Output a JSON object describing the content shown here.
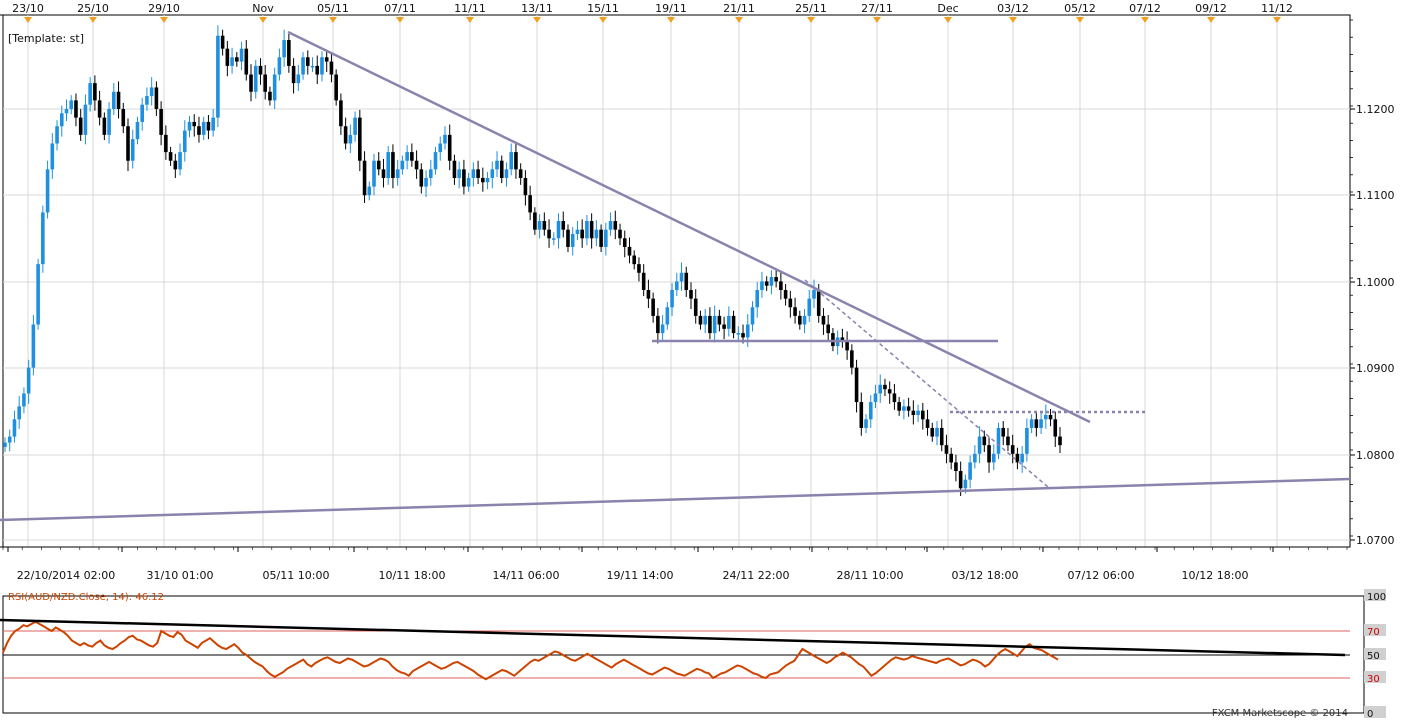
{
  "chart_data": [
    {
      "type": "candlestick",
      "symbol": "AUD/NZD",
      "template_label": "[Template: st]",
      "top_axis_labels": [
        "23/10",
        "25/10",
        "29/10",
        "Nov",
        "05/11",
        "07/11",
        "11/11",
        "13/11",
        "15/11",
        "19/11",
        "21/11",
        "25/11",
        "27/11",
        "Dec",
        "03/12",
        "05/12",
        "07/12",
        "09/12",
        "11/12"
      ],
      "bottom_axis_labels": [
        "22/10/2014 02:00",
        "31/10 01:00",
        "05/11 10:00",
        "10/11 18:00",
        "14/11 06:00",
        "19/11 14:00",
        "24/11 22:00",
        "28/11 10:00",
        "03/12 18:00",
        "07/12 06:00",
        "10/12 18:00"
      ],
      "y_ticks": [
        "1.0700",
        "1.0800",
        "1.0900",
        "1.1000",
        "1.1100",
        "1.1200"
      ],
      "ylim": [
        1.068,
        1.13
      ],
      "series_close": [
        1.0813,
        1.082,
        1.084,
        1.0855,
        1.087,
        1.09,
        1.095,
        1.102,
        1.108,
        1.113,
        1.116,
        1.118,
        1.1195,
        1.12,
        1.121,
        1.119,
        1.117,
        1.1205,
        1.123,
        1.121,
        1.119,
        1.117,
        1.12,
        1.122,
        1.12,
        1.118,
        1.114,
        1.1165,
        1.1185,
        1.1205,
        1.1215,
        1.1225,
        1.12,
        1.117,
        1.115,
        1.114,
        1.113,
        1.115,
        1.1175,
        1.1185,
        1.118,
        1.117,
        1.1185,
        1.1175,
        1.119,
        1.1285,
        1.127,
        1.125,
        1.126,
        1.1255,
        1.127,
        1.124,
        1.122,
        1.125,
        1.124,
        1.122,
        1.121,
        1.124,
        1.126,
        1.128,
        1.125,
        1.123,
        1.124,
        1.126,
        1.125,
        1.125,
        1.124,
        1.126,
        1.1255,
        1.124,
        1.121,
        1.118,
        1.116,
        1.117,
        1.119,
        1.114,
        1.11,
        1.111,
        1.114,
        1.113,
        1.112,
        1.115,
        1.112,
        1.113,
        1.114,
        1.115,
        1.114,
        1.113,
        1.111,
        1.112,
        1.113,
        1.115,
        1.116,
        1.117,
        1.114,
        1.112,
        1.113,
        1.111,
        1.112,
        1.113,
        1.112,
        1.1115,
        1.112,
        1.113,
        1.114,
        1.112,
        1.113,
        1.115,
        1.113,
        1.112,
        1.11,
        1.108,
        1.106,
        1.107,
        1.106,
        1.105,
        1.105,
        1.107,
        1.106,
        1.104,
        1.1055,
        1.106,
        1.105,
        1.107,
        1.105,
        1.106,
        1.104,
        1.106,
        1.107,
        1.106,
        1.105,
        1.104,
        1.103,
        1.102,
        1.101,
        1.099,
        1.098,
        1.096,
        1.094,
        1.095,
        1.097,
        1.099,
        1.1,
        1.101,
        1.099,
        1.098,
        1.096,
        1.095,
        1.096,
        1.094,
        1.096,
        1.095,
        1.0945,
        1.096,
        1.094,
        1.094,
        1.0935,
        1.095,
        1.097,
        1.099,
        1.1,
        1.0995,
        1.1005,
        1.1,
        1.099,
        1.098,
        1.097,
        1.096,
        1.095,
        1.096,
        1.098,
        1.099,
        1.096,
        1.095,
        1.094,
        1.0925,
        1.0935,
        1.093,
        1.092,
        1.09,
        1.086,
        1.083,
        1.084,
        1.086,
        1.087,
        1.088,
        1.0875,
        1.087,
        1.086,
        1.085,
        1.0855,
        1.085,
        1.0845,
        1.085,
        1.084,
        1.083,
        1.082,
        1.083,
        1.081,
        1.08,
        1.079,
        1.078,
        1.076,
        1.077,
        1.079,
        1.08,
        1.082,
        1.081,
        1.079,
        1.08,
        1.083,
        1.082,
        1.081,
        1.08,
        1.079,
        1.08,
        1.083,
        1.084,
        1.083,
        1.084,
        1.0845,
        1.084,
        1.082,
        1.081
      ]
    },
    {
      "type": "line",
      "title": "RSI(AUD/NZD.Close, 14): 46.12",
      "y_ticks": [
        "100",
        "70",
        "50",
        "30",
        "0"
      ],
      "ylim": [
        0,
        100
      ],
      "values": [
        52,
        60,
        66,
        70,
        72,
        75,
        74,
        76,
        78,
        76,
        74,
        72,
        70,
        73,
        71,
        69,
        66,
        62,
        60,
        58,
        60,
        58,
        57,
        60,
        62,
        58,
        56,
        55,
        57,
        60,
        62,
        65,
        66,
        63,
        62,
        60,
        58,
        57,
        60,
        70,
        68,
        66,
        65,
        69,
        67,
        62,
        60,
        58,
        56,
        60,
        62,
        64,
        61,
        58,
        56,
        55,
        57,
        59,
        56,
        52,
        50,
        47,
        44,
        42,
        40,
        36,
        33,
        31,
        33,
        35,
        38,
        40,
        42,
        44,
        46,
        42,
        40,
        43,
        45,
        47,
        48,
        46,
        44,
        43,
        45,
        47,
        46,
        44,
        42,
        40,
        41,
        43,
        45,
        47,
        46,
        44,
        40,
        37,
        35,
        34,
        32,
        36,
        38,
        40,
        42,
        44,
        42,
        40,
        38,
        39,
        41,
        43,
        44,
        42,
        40,
        38,
        36,
        33,
        31,
        29,
        31,
        33,
        35,
        37,
        36,
        34,
        32,
        35,
        38,
        41,
        44,
        46,
        45,
        47,
        49,
        51,
        53,
        52,
        50,
        48,
        46,
        45,
        47,
        49,
        51,
        49,
        47,
        45,
        43,
        41,
        39,
        42,
        44,
        46,
        44,
        42,
        40,
        38,
        36,
        34,
        33,
        35,
        37,
        39,
        38,
        36,
        34,
        33,
        32,
        34,
        36,
        38,
        37,
        35,
        34,
        30,
        32,
        34,
        35,
        37,
        39,
        41,
        40,
        38,
        36,
        34,
        33,
        31,
        30,
        33,
        34,
        35,
        38,
        41,
        43,
        45,
        50,
        55,
        53,
        51,
        49,
        47,
        45,
        43,
        45,
        48,
        50,
        52,
        50,
        48,
        45,
        42,
        40,
        36,
        32,
        34,
        37,
        40,
        43,
        46,
        48,
        47,
        46,
        47,
        49,
        48,
        47,
        46,
        45,
        44,
        43,
        45,
        46,
        47,
        45,
        43,
        41,
        42,
        44,
        46,
        45,
        43,
        40,
        42,
        46,
        50,
        53,
        55,
        53,
        51,
        49,
        53,
        57,
        59,
        56,
        55,
        54,
        52,
        50,
        48,
        46
      ],
      "reference_levels": [
        70,
        30
      ]
    }
  ],
  "footer": {
    "copyright": "FXCM Marketscope © 2014"
  },
  "colors": {
    "bull": "#1f8fe0",
    "bear": "#000000",
    "trend": "#8a83ad",
    "rsi": "#cc4400",
    "ref": "#e06060",
    "grid": "#d9d9d9"
  }
}
